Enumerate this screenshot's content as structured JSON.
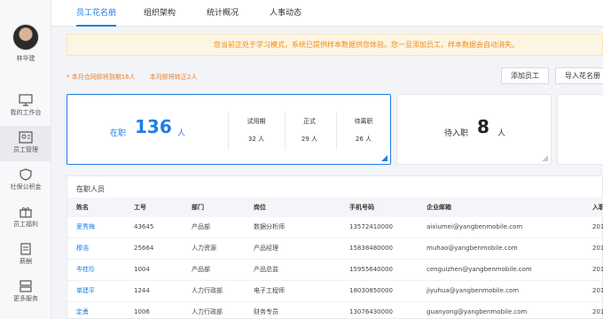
{
  "user": {
    "name": "林华建"
  },
  "sidebar": {
    "items": [
      {
        "label": "我的工作台",
        "icon": "monitor-icon"
      },
      {
        "label": "员工管理",
        "icon": "id-card-icon"
      },
      {
        "label": "社保公积金",
        "icon": "shield-icon"
      },
      {
        "label": "员工福利",
        "icon": "gift-icon"
      },
      {
        "label": "薪酬",
        "icon": "document-icon"
      },
      {
        "label": "更多服务",
        "icon": "grid-icon"
      }
    ]
  },
  "tabs": [
    "员工花名册",
    "组织架构",
    "统计概况",
    "人事动态"
  ],
  "notice": "您当前正处于学习模式，系统已提供样本数据供您体验。您一旦添加员工，样本数据会自动消失。",
  "alerts": [
    "* 本月合同即将到期16人",
    "本月即将转正2人"
  ],
  "buttons": {
    "add": "添加员工",
    "import": "导入花名册"
  },
  "summary": {
    "onjob_label": "在职",
    "onjob_count": "136",
    "onjob_unit": "人",
    "probation_label": "试用期",
    "probation_value": "32 人",
    "regular_label": "正式",
    "regular_value": "29 人",
    "leaving_label": "待离职",
    "leaving_value": "26 人",
    "pending_label": "待入职",
    "pending_count": "8",
    "pending_unit": "人"
  },
  "list": {
    "title": "在职人员",
    "headers": [
      "姓名",
      "工号",
      "部门",
      "岗位",
      "手机号码",
      "企业邮箱",
      "入职"
    ],
    "rows": [
      [
        "爱秀梅",
        "43645",
        "产品部",
        "数据分析师",
        "13572410000",
        "aixiumei@yangbenmobile.com",
        "201"
      ],
      [
        "穆浩",
        "25664",
        "人力资源",
        "产品经理",
        "15838480000",
        "muhao@yangbenmobile.com",
        "201"
      ],
      [
        "岑桂珍",
        "1004",
        "产品部",
        "产品总监",
        "15955640000",
        "cenguizhen@yangbenmobile.com",
        "201"
      ],
      [
        "单建平",
        "1244",
        "人力行政部",
        "电子工程师",
        "18030850000",
        "jiyuhua@yangbenmobile.com",
        "201"
      ],
      [
        "定勇",
        "1006",
        "人力行政部",
        "财务专员",
        "13076430000",
        "guanyong@yangbenmobile.com",
        "201"
      ]
    ]
  },
  "colors": {
    "accent": "#1e7ee6",
    "warning": "#f08a1a"
  }
}
